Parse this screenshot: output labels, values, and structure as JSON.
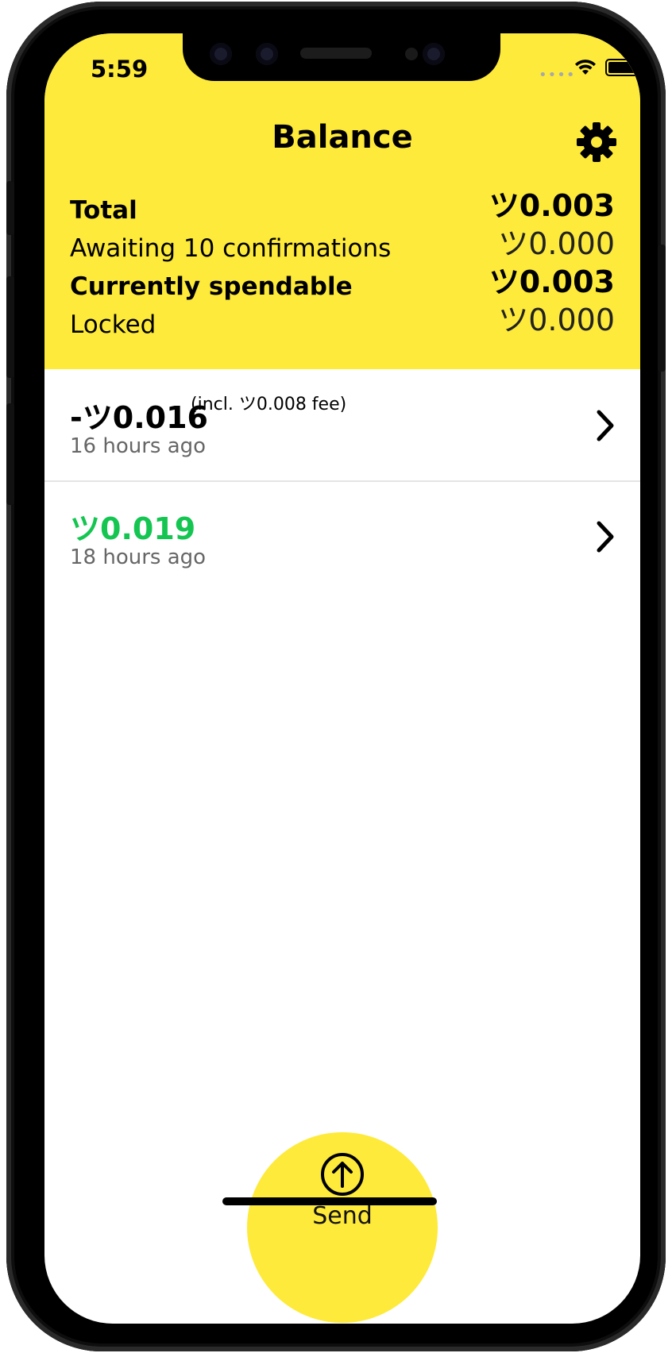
{
  "status_bar": {
    "time": "5:59",
    "signal": "••••"
  },
  "header": {
    "title": "Balance"
  },
  "balances": [
    {
      "label": "Total",
      "value": "ツ0.003",
      "style": "bold"
    },
    {
      "label": "Awaiting 10 confirmations",
      "value": "ツ0.000",
      "style": "light"
    },
    {
      "label": "Currently spendable",
      "value": "ツ0.003",
      "style": "bold"
    },
    {
      "label": "Locked",
      "value": "ツ0.000",
      "style": "light"
    }
  ],
  "transactions": [
    {
      "amount": "-ツ0.016",
      "fee": "(incl. ツ0.008 fee)",
      "time": "16 hours ago",
      "color": "#000000"
    },
    {
      "amount": "ツ0.019",
      "fee": "",
      "time": "18 hours ago",
      "color": "#14c651"
    }
  ],
  "send": {
    "label": "Send"
  },
  "colors": {
    "accent": "#feea3a",
    "incoming": "#14c651"
  },
  "icons": {
    "settings": "gear-icon",
    "send": "arrow-up-circle-icon",
    "row": "chevron-right-icon"
  }
}
